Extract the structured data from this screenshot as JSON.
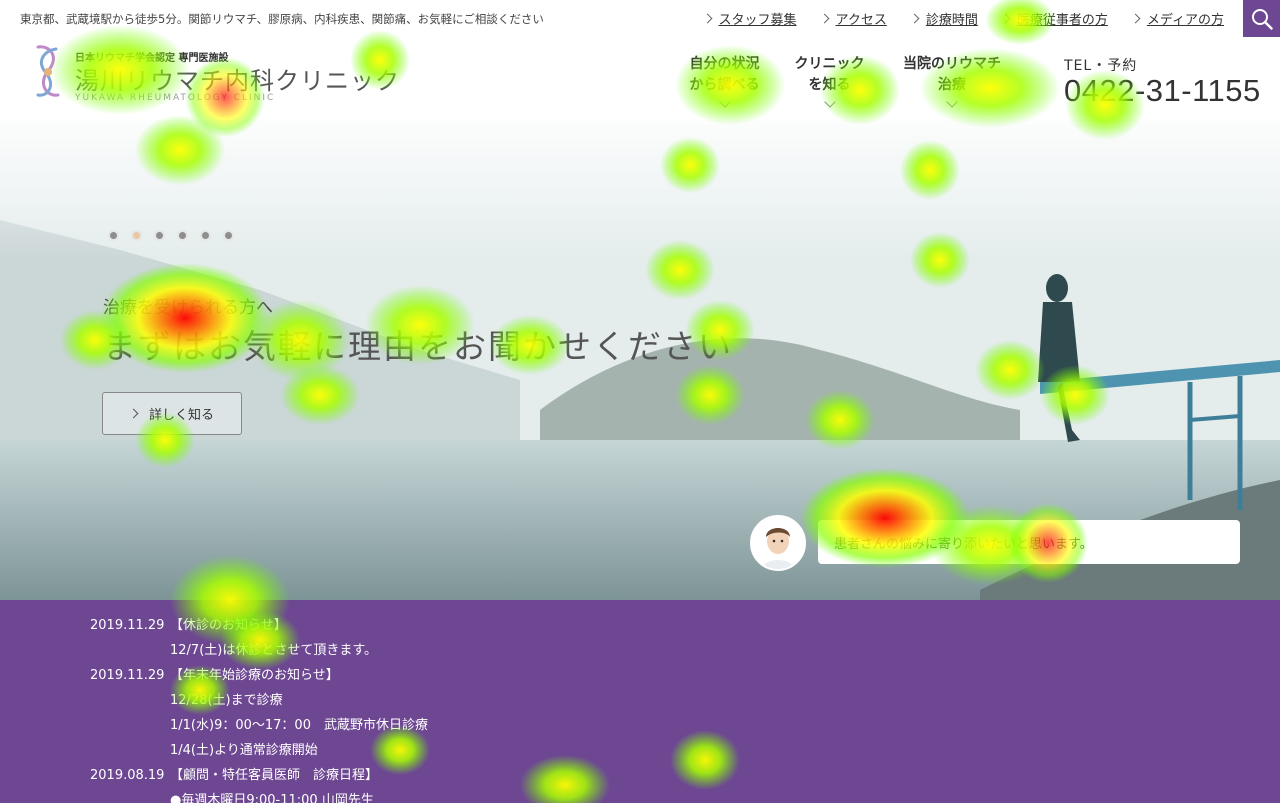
{
  "topbar": {
    "intro": "東京都、武蔵境駅から徒歩5分。関節リウマチ、膠原病、内科疾患、関節痛、お気軽にご相談ください",
    "links": [
      {
        "label": "スタッフ募集"
      },
      {
        "label": "アクセス"
      },
      {
        "label": "診療時間"
      },
      {
        "label": "医療従事者の方"
      },
      {
        "label": "メディアの方"
      }
    ],
    "search_icon": "search-icon"
  },
  "header": {
    "logo_sub": "日本リウマチ学会認定 専門医施設",
    "logo_name": "湯川リウマチ内科クリニック",
    "logo_en": "YUKAWA RHEUMATOLOGY CLINIC",
    "nav": [
      {
        "line1": "自分の状況",
        "line2": "から調べる"
      },
      {
        "line1": "クリニック",
        "line2": "を知る"
      },
      {
        "line1": "当院のリウマチ",
        "line2": "治療"
      }
    ],
    "tel_label": "TEL・予約",
    "tel_number": "0422-31-1155"
  },
  "hero": {
    "slides_total": 6,
    "active_slide": 2,
    "lead": "治療を受けられる方へ",
    "catch": "まずはお気軽に理由をお聞かせください",
    "more_button": "詳しく知る",
    "bubble_text": "患者さんの悩みに寄り添いたいと思います。"
  },
  "news": {
    "items": [
      {
        "date": "2019.11.29",
        "title": "【休診のお知らせ】",
        "lines": [
          "12/7(土)は休診とさせて頂きます。"
        ]
      },
      {
        "date": "2019.11.29",
        "title": "【年末年始診療のお知らせ】",
        "lines": [
          "12/28(土)まで診療",
          "1/1(水)9：00〜17：00　武蔵野市休日診療",
          "1/4(土)より通常診療開始"
        ]
      },
      {
        "date": "2019.08.19",
        "title": "【顧問・特任客員医師　診療日程】",
        "lines": [
          "●毎週木曜日9:00-11:00 山岡先生"
        ]
      }
    ]
  },
  "colors": {
    "brand_purple": "#6e4793",
    "active_dot": "#e9c7a3"
  }
}
